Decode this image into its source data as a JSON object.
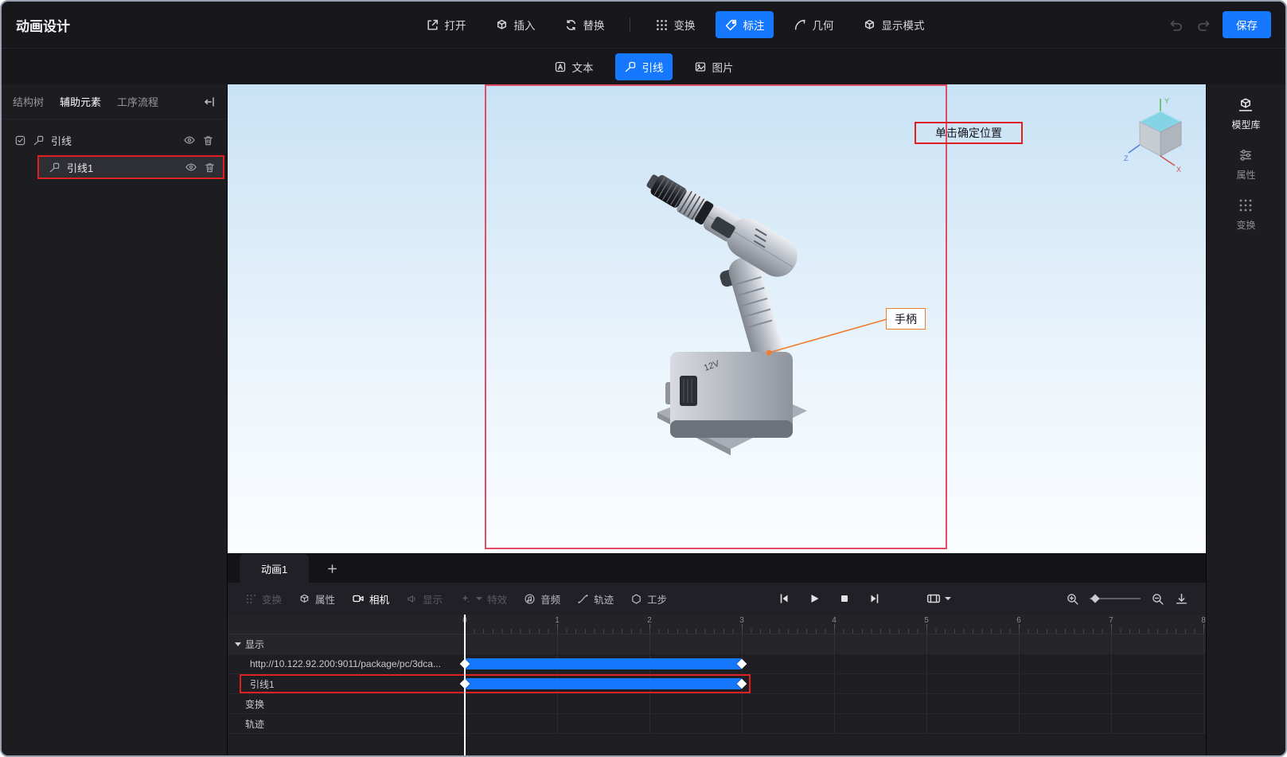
{
  "app": {
    "title": "动画设计"
  },
  "header": {
    "items": [
      {
        "label": "打开"
      },
      {
        "label": "插入"
      },
      {
        "label": "替换"
      },
      {
        "label": "变换"
      },
      {
        "label": "标注",
        "active": true
      },
      {
        "label": "几何"
      },
      {
        "label": "显示模式"
      }
    ],
    "save": "保存"
  },
  "subbar": {
    "items": [
      {
        "label": "文本"
      },
      {
        "label": "引线",
        "active": true
      },
      {
        "label": "图片"
      }
    ]
  },
  "left_panel": {
    "tabs": [
      "结构树",
      "辅助元素",
      "工序流程"
    ],
    "tree": {
      "group": "引线",
      "child": "引线1"
    }
  },
  "viewport": {
    "hint": "单击确定位置",
    "leader_label": "手柄",
    "model_label": "12V",
    "viewcube": {
      "x": "X",
      "y": "Y",
      "z": "Z"
    }
  },
  "right_panel": {
    "items": [
      "模型库",
      "属性",
      "变换"
    ]
  },
  "timeline": {
    "tab": "动画1",
    "tools": [
      "变换",
      "属性",
      "相机",
      "显示",
      "特效",
      "音频",
      "轨迹",
      "工步"
    ],
    "ruler": [
      "0",
      "1",
      "2",
      "3",
      "4",
      "5",
      "6",
      "7",
      "8"
    ],
    "rows": [
      {
        "label": "显示",
        "type": "group"
      },
      {
        "label": "http://10.122.92.200:9011/package/pc/3dca...",
        "bar": {
          "start": 0,
          "end": 3
        }
      },
      {
        "label": "引线1",
        "bar": {
          "start": 0,
          "end": 3
        },
        "highlight": true
      },
      {
        "label": "变换",
        "type": "group"
      },
      {
        "label": "轨迹",
        "type": "group"
      }
    ]
  },
  "colors": {
    "accent": "#1677ff",
    "highlight_red": "#e02020",
    "frame_pink": "#e24b66",
    "leader_orange": "#ed7d31"
  }
}
